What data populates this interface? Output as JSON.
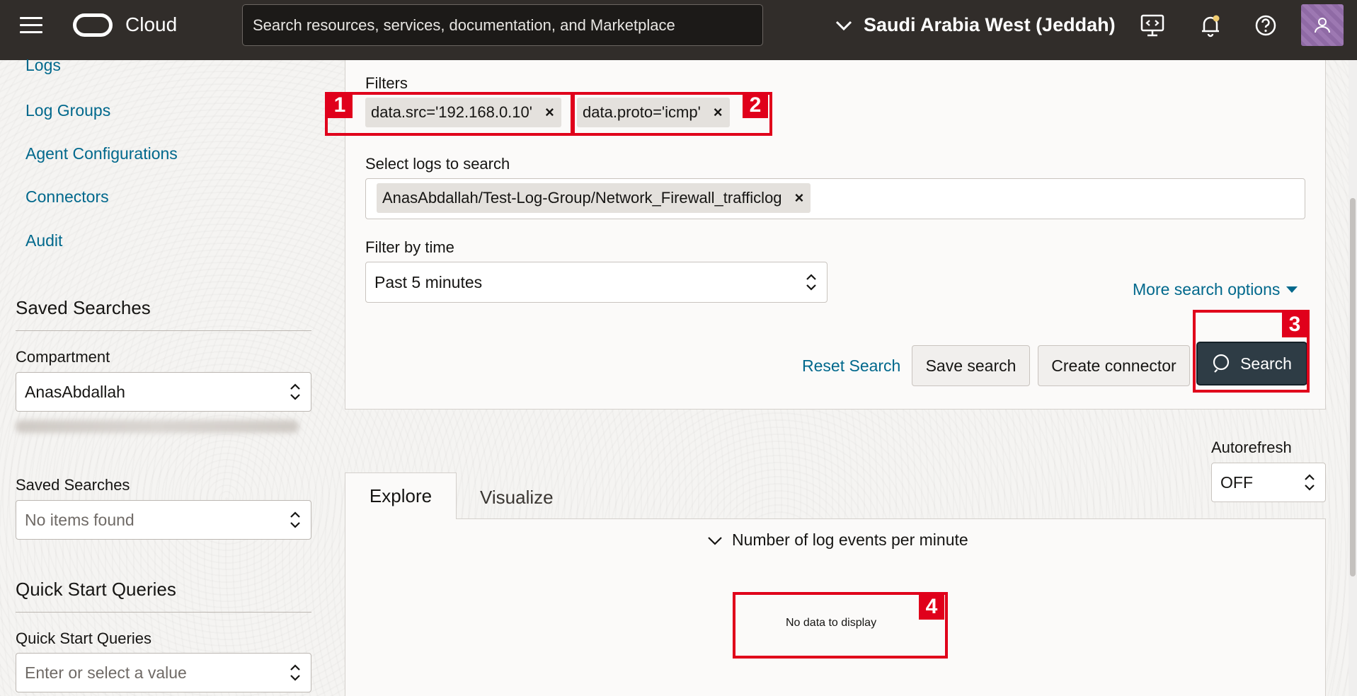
{
  "topbar": {
    "brand": "Cloud",
    "search_placeholder": "Search resources, services, documentation, and Marketplace",
    "region": "Saudi Arabia West (Jeddah)"
  },
  "sidebar": {
    "links": [
      "Logs",
      "Log Groups",
      "Agent Configurations",
      "Connectors",
      "Audit"
    ],
    "saved_searches_heading": "Saved Searches",
    "compartment_label": "Compartment",
    "compartment_value": "AnasAbdallah",
    "saved_searches_label": "Saved Searches",
    "saved_searches_value": "No items found",
    "quick_start_heading": "Quick Start Queries",
    "quick_start_label": "Quick Start Queries",
    "quick_start_placeholder": "Enter or select a value"
  },
  "search_panel": {
    "filters_label": "Filters",
    "filters": [
      "data.src='192.168.0.10'",
      "data.proto='icmp'"
    ],
    "logs_label": "Select logs to search",
    "logs": [
      "AnasAbdallah/Test-Log-Group/Network_Firewall_trafficlog"
    ],
    "time_label": "Filter by time",
    "time_value": "Past 5 minutes",
    "more_options": "More search options",
    "reset": "Reset Search",
    "save": "Save search",
    "create_connector": "Create connector",
    "search": "Search"
  },
  "autorefresh": {
    "label": "Autorefresh",
    "value": "OFF"
  },
  "tabs": [
    "Explore",
    "Visualize"
  ],
  "results": {
    "events_toggle": "Number of log events per minute",
    "no_data": "No data to display"
  },
  "annotations": [
    "1",
    "2",
    "3",
    "4"
  ],
  "colors": {
    "topbar": "#312d2a",
    "link": "#00688c",
    "primary_button": "#2e3c45",
    "annotation": "#e0001b"
  }
}
